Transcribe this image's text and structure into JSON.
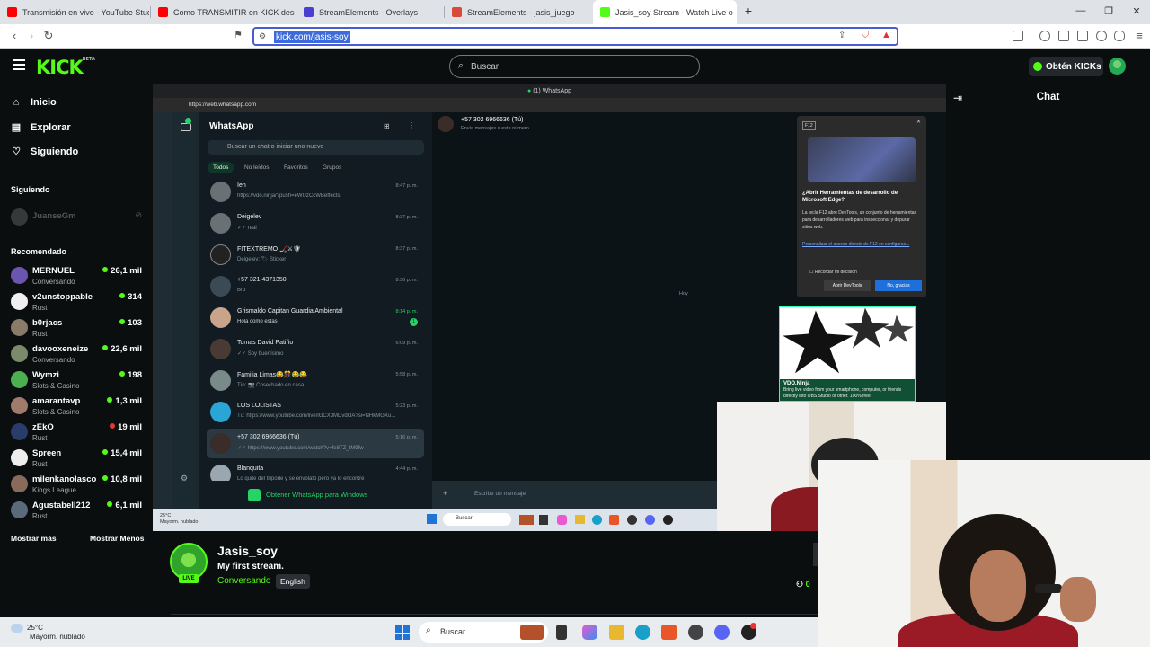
{
  "browser": {
    "tabs": [
      {
        "label": "Transmisión en vivo - YouTube Studio",
        "color": "#ff0000"
      },
      {
        "label": "Como TRANSMITIR en KICK desde P",
        "color": "#ff0000"
      },
      {
        "label": "StreamElements - Overlays",
        "color": "#4b3fd1"
      },
      {
        "label": "StreamElements - jasis_juego",
        "color": "#d84a3a"
      },
      {
        "label": "Jasis_soy Stream - Watch Live o",
        "color": "#53fc18"
      }
    ],
    "url": "kick.com/jasis-soy"
  },
  "kick": {
    "logo": "KICK",
    "logo_tag": "BETA",
    "search_placeholder": "Buscar",
    "kicks_button": "Obtén KICKs",
    "nav": {
      "home": "Inicio",
      "explore": "Explorar",
      "following": "Siguiendo"
    },
    "following_section": "Siguiendo",
    "following_user": "JuanseGm",
    "recommended_section": "Recomendado",
    "recommended": [
      {
        "name": "MERNUEL",
        "category": "Conversando",
        "viewers": "26,1 mil",
        "live": true,
        "color": "#6a56b0"
      },
      {
        "name": "v2unstoppable",
        "category": "Rust",
        "viewers": "314",
        "live": true,
        "color": "#f0f0f0"
      },
      {
        "name": "b0rjacs",
        "category": "Rust",
        "viewers": "103",
        "live": true,
        "color": "#8a7a6a"
      },
      {
        "name": "davooxeneize",
        "category": "Conversando",
        "viewers": "22,6 mil",
        "live": true,
        "color": "#7a8a6a"
      },
      {
        "name": "Wymzi",
        "category": "Slots & Casino",
        "viewers": "198",
        "live": true,
        "color": "#4caf50"
      },
      {
        "name": "amarantavp",
        "category": "Slots & Casino",
        "viewers": "1,3 mil",
        "live": true,
        "color": "#a07a6a"
      },
      {
        "name": "zEkO",
        "category": "Rust",
        "viewers": "19 mil",
        "live": false,
        "color": "#2a3d6a"
      },
      {
        "name": "Spreen",
        "category": "Rust",
        "viewers": "15,4 mil",
        "live": true,
        "color": "#eeeeee"
      },
      {
        "name": "milenkanolasco",
        "category": "Kings League",
        "viewers": "10,8 mil",
        "live": true,
        "color": "#8a6a5a"
      },
      {
        "name": "Agustabell212",
        "category": "Rust",
        "viewers": "6,1 mil",
        "live": true,
        "color": "#5a6a7a"
      }
    ],
    "show_more": "Mostrar más",
    "show_less": "Mostrar Menos",
    "chat_title": "Chat",
    "stream": {
      "streamer": "Jasis_soy",
      "title": "My first stream.",
      "category": "Conversando",
      "language": "English",
      "live_badge": "LIVE",
      "side_count": "0"
    }
  },
  "video": {
    "window_title": "(1) WhatsApp",
    "url": "https://web.whatsapp.com",
    "wa_title": "WhatsApp",
    "wa_search": "Buscar un chat o iniciar uno nuevo",
    "filters": [
      "Todos",
      "No leídos",
      "Favoritos",
      "Grupos"
    ],
    "chats": [
      {
        "name": "Ien",
        "msg": "https://vdo.ninja/?push=eWUzCcWBeffects",
        "time": "8:47 p. m."
      },
      {
        "name": "Deigelev",
        "msg": "✓✓ real",
        "time": "8:37 p. m."
      },
      {
        "name": "FITEXTREMO 🏒⚔🛡",
        "msg": "Deigelev: 🏷 Sticker",
        "time": "8:37 p. m."
      },
      {
        "name": "+57 321 4371350",
        "msg": "Bro",
        "time": "8:36 p. m."
      },
      {
        "name": "Grismaldo Capitan Guardia Ambiental",
        "msg": "Hola como estas",
        "time": "8:14 p. m.",
        "badge": "1"
      },
      {
        "name": "Tomas David Patiño",
        "msg": "✓✓ Soy buenísimo",
        "time": "6:09 p. m."
      },
      {
        "name": "Familia Limas😂🎊😂😂",
        "msg": "Tío: 📷 Cosechado en casa",
        "time": "5:58 p. m."
      },
      {
        "name": "LOS LOLISTAS",
        "msg": "Tú: https://www.youtube.com/live/lGCX3MDvdOA?si=NHkMGXu...",
        "time": "5:23 p. m."
      },
      {
        "name": "+57 302 6966636 (Tú)",
        "msg": "✓✓ https://www.youtube.com/watch?v=fe8TZ_IM9fw",
        "time": "5:16 p. m."
      },
      {
        "name": "Blanquita",
        "msg": "Lo quite del trípode y se envolató pero ya lo encontré",
        "time": "4:44 p. m."
      }
    ],
    "get_app": "Obtener WhatsApp para Windows",
    "chat_name": "+57 302 6966636 (Tú)",
    "chat_sub": "Envía mensajes a este número.",
    "chat_today": "Hoy",
    "chat_input": "Escribe un mensaje",
    "devtools": {
      "key": "F12",
      "heading": "¿Abrir Herramientas de desarrollo de Microsoft Edge?",
      "body": "La tecla F12 abre DevTools, un conjunto de herramientas para desarrolladores web para inspeccionar y depurar sitios web.",
      "link": "Personalizar el acceso directo de F12 en configurac...",
      "remember": "Recordar mi decisión",
      "open_btn": "Abrir DevTools",
      "no_btn": "No, gracias"
    },
    "vdo": {
      "title": "VDO.Ninja",
      "text": "Bring live video from your smartphone, computer, or friends directly into OBS Studio or other. 100% free"
    },
    "taskbar_weather": "25°C",
    "taskbar_weather_sub": "Mayorm. nublado",
    "taskbar_search": "Buscar"
  },
  "taskbar": {
    "temp": "25°C",
    "condition": "Mayorm. nublado",
    "search": "Buscar"
  }
}
